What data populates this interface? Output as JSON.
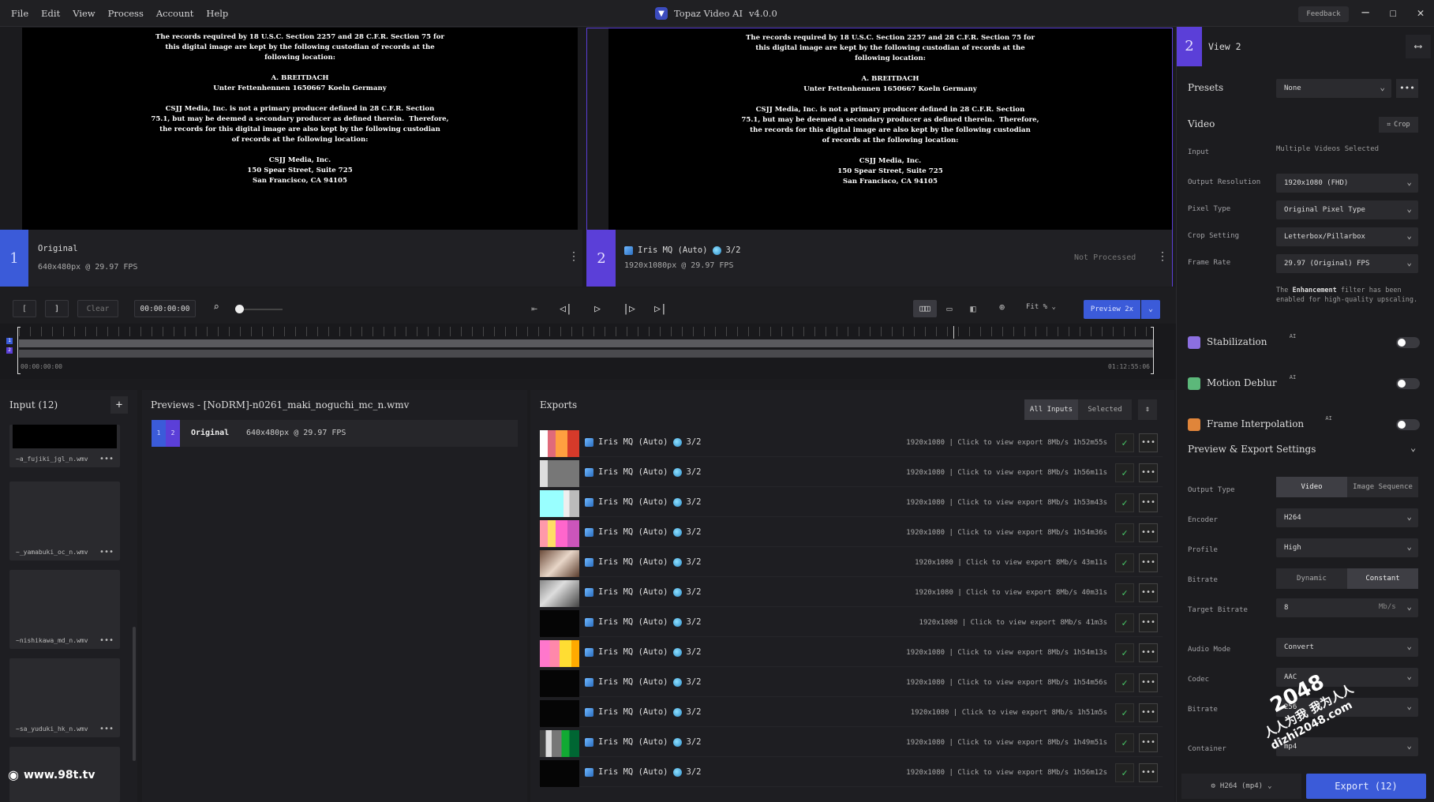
{
  "menu": [
    "File",
    "Edit",
    "View",
    "Process",
    "Account",
    "Help"
  ],
  "app": {
    "title": "Topaz Video AI",
    "version": "v4.0.0",
    "feedback": "Feedback"
  },
  "window_controls": {
    "minimize": "─",
    "maximize": "☐",
    "close": "✕"
  },
  "legal_text": "The records required by 18 U.S.C. Section 2257 and 28 C.F.R. Section 75 for\nthis digital image are kept by the following custodian of records at the\nfollowing location:\n\nA. BREITDACH\nUnter Fettenhennen 1650667 Koeln Germany\n\nCSJJ Media, Inc. is not a primary producer defined in 28 C.F.R. Section\n75.1, but may be deemed a secondary producer as defined therein.  Therefore,\nthe records for this digital image are also kept by the following custodian\nof records at the following location:\n\nCSJJ Media, Inc.\n150 Spear Street, Suite 725\nSan Francisco, CA 94105",
  "view1": {
    "num": "1",
    "title": "Original",
    "info": "640x480px @ 29.97 FPS"
  },
  "view2": {
    "num": "2",
    "model": "Iris MQ (Auto)",
    "passes": "3/2",
    "info": "1920x1080px @ 29.97 FPS",
    "status": "Not Processed"
  },
  "controls": {
    "in_btn": "[",
    "out_btn": "]",
    "clear": "Clear",
    "timecode": "00:00:00:00",
    "fit": "Fit %",
    "preview": "Preview 2x"
  },
  "timeline": {
    "start": "00:00:00:00",
    "end": "01:12:55:06",
    "track1": "1",
    "track2": "2"
  },
  "input": {
    "title": "Input (12)",
    "add": "+",
    "files": [
      "~a_fujiki_jgl_n.wmv",
      "~_yamabuki_oc_n.wmv",
      "~nishikawa_md_n.wmv",
      "~sa_yuduki_hk_n.wmv"
    ]
  },
  "previews": {
    "title": "Previews - [NoDRM]-n0261_maki_noguchi_mc_n.wmv",
    "row_nums": [
      "1",
      "2"
    ],
    "row_label": "Original",
    "row_info": "640x480px @ 29.97 FPS"
  },
  "watermark_left": "www.98t.tv",
  "exports": {
    "title": "Exports",
    "filter_all": "All Inputs",
    "filter_selected": "Selected",
    "rows": [
      {
        "model": "Iris MQ (Auto)",
        "passes": "3/2",
        "res": "1920x1080",
        "link": "Click to view export",
        "rate": "8Mb/s",
        "dur": "1h52m55s",
        "thumb": "linear-gradient(90deg,#fff 0 20%,#e06a7a 20% 40%,#ff9f40 40% 70%,#d63a2a 70%)"
      },
      {
        "model": "Iris MQ (Auto)",
        "passes": "3/2",
        "res": "1920x1080",
        "link": "Click to view export",
        "rate": "8Mb/s",
        "dur": "1h56m11s",
        "thumb": "linear-gradient(90deg,#ddd 0 20%,#777 20%)"
      },
      {
        "model": "Iris MQ (Auto)",
        "passes": "3/2",
        "res": "1920x1080",
        "link": "Click to view export",
        "rate": "8Mb/s",
        "dur": "1h53m43s",
        "thumb": "linear-gradient(90deg,#9ff 0 60%,#eee 60% 75%,#bbb 75%)"
      },
      {
        "model": "Iris MQ (Auto)",
        "passes": "3/2",
        "res": "1920x1080",
        "link": "Click to view export",
        "rate": "8Mb/s",
        "dur": "1h54m36s",
        "thumb": "linear-gradient(90deg,#f9a 0 20%,#fd6 20% 40%,#f6c 40% 70%,#c5b 70%)"
      },
      {
        "model": "Iris MQ (Auto)",
        "passes": "3/2",
        "res": "1920x1080",
        "link": "Click to view export",
        "rate": "8Mb/s",
        "dur": "43m11s",
        "thumb": "linear-gradient(135deg,#6b4b3a,#e8d6c8 50%,#5a3c2c)"
      },
      {
        "model": "Iris MQ (Auto)",
        "passes": "3/2",
        "res": "1920x1080",
        "link": "Click to view export",
        "rate": "8Mb/s",
        "dur": "40m31s",
        "thumb": "linear-gradient(135deg,#888,#ddd 40%,#444)"
      },
      {
        "model": "Iris MQ (Auto)",
        "passes": "3/2",
        "res": "1920x1080",
        "link": "Click to view export",
        "rate": "8Mb/s",
        "dur": "41m3s",
        "thumb": "#050505"
      },
      {
        "model": "Iris MQ (Auto)",
        "passes": "3/2",
        "res": "1920x1080",
        "link": "Click to view export",
        "rate": "8Mb/s",
        "dur": "1h54m13s",
        "thumb": "linear-gradient(90deg,#f7c 0 25%,#f8a 25% 50%,#fd3 50% 80%,#fa0 80%)"
      },
      {
        "model": "Iris MQ (Auto)",
        "passes": "3/2",
        "res": "1920x1080",
        "link": "Click to view export",
        "rate": "8Mb/s",
        "dur": "1h54m56s",
        "thumb": "#050505"
      },
      {
        "model": "Iris MQ (Auto)",
        "passes": "3/2",
        "res": "1920x1080",
        "link": "Click to view export",
        "rate": "8Mb/s",
        "dur": "1h51m5s",
        "thumb": "#050505"
      },
      {
        "model": "Iris MQ (Auto)",
        "passes": "3/2",
        "res": "1920x1080",
        "link": "Click to view export",
        "rate": "8Mb/s",
        "dur": "1h49m51s",
        "thumb": "linear-gradient(90deg,#444 0 15%,#ddd 15% 30%,#777 30% 55%,#1a3 55% 75%,#063 75%)"
      },
      {
        "model": "Iris MQ (Auto)",
        "passes": "3/2",
        "res": "1920x1080",
        "link": "Click to view export",
        "rate": "8Mb/s",
        "dur": "1h56m12s",
        "thumb": "#050505"
      }
    ]
  },
  "right": {
    "view_num": "2",
    "view_title": "View 2",
    "presets_label": "Presets",
    "presets_value": "None",
    "video_label": "Video",
    "crop": "Crop",
    "input_label": "Input",
    "input_value": "Multiple Videos Selected",
    "rows": [
      {
        "label": "Output Resolution",
        "value": "1920x1080 (FHD)"
      },
      {
        "label": "Pixel Type",
        "value": "Original Pixel Type"
      },
      {
        "label": "Crop Setting",
        "value": "Letterbox/Pillarbox"
      },
      {
        "label": "Frame Rate",
        "value": "29.97 (Original) FPS"
      }
    ],
    "note_pre": "The",
    "note_bold": "Enhancement",
    "note_post": "filter has been enabled for high-quality upscaling.",
    "filters": [
      {
        "label": "Stabilization",
        "ai": "AI",
        "color": "#8c6fe0"
      },
      {
        "label": "Motion Deblur",
        "ai": "AI",
        "color": "#5cb87a"
      },
      {
        "label": "Frame Interpolation",
        "ai": "AI",
        "color": "#e0853a"
      }
    ],
    "export_settings": "Preview & Export Settings",
    "output_type_label": "Output Type",
    "output_video": "Video",
    "output_seq": "Image Sequence",
    "encoder_label": "Encoder",
    "encoder": "H264",
    "profile_label": "Profile",
    "profile": "High",
    "bitrate_label": "Bitrate",
    "bitrate_dynamic": "Dynamic",
    "bitrate_constant": "Constant",
    "target_label": "Target Bitrate",
    "target": "8",
    "target_unit": "Mb/s",
    "audio_label": "Audio Mode",
    "audio": "Convert",
    "codec_label": "Codec",
    "codec": "AAC",
    "abitrate_label": "Bitrate",
    "abitrate": "256",
    "container_label": "Container",
    "container": "mp4",
    "footer_format": "H264 (mp4)",
    "export_btn": "Export (12)"
  },
  "watermark_right": {
    "a": "2048",
    "b": "人人为我 我为人人",
    "c": "dizhi2048.com"
  },
  "colors": {
    "accent": "#5b3fd8",
    "button_blue": "#3b5bd9",
    "check": "#4ad26b"
  }
}
